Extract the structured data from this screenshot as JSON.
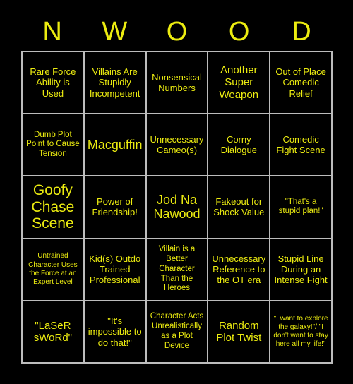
{
  "card": {
    "title_letters": [
      "N",
      "W",
      "O",
      "O",
      "D"
    ],
    "accent_color": "#ecec10",
    "background_color": "#000000",
    "gridline_color": "#bcbcbc",
    "rows": 5,
    "columns": 5,
    "cells": [
      {
        "text": "Rare Force Ability is Used",
        "size": "m"
      },
      {
        "text": "Villains Are Stupidly Incompetent",
        "size": "m"
      },
      {
        "text": "Nonsensical Numbers",
        "size": "m"
      },
      {
        "text": "Another Super Weapon",
        "size": "l"
      },
      {
        "text": "Out of Place Comedic Relief",
        "size": "m"
      },
      {
        "text": "Dumb Plot Point to Cause Tension",
        "size": "s"
      },
      {
        "text": "Macguffin",
        "size": "xl"
      },
      {
        "text": "Unnecessary Cameo(s)",
        "size": "m"
      },
      {
        "text": "Corny Dialogue",
        "size": "m"
      },
      {
        "text": "Comedic Fight Scene",
        "size": "m"
      },
      {
        "text": "Goofy Chase Scene",
        "size": "xxl"
      },
      {
        "text": "Power of Friendship!",
        "size": "m"
      },
      {
        "text": "Jod Na Nawood",
        "size": "xl"
      },
      {
        "text": "Fakeout for Shock Value",
        "size": "m"
      },
      {
        "text": "\"That's a stupid plan!\"",
        "size": "s"
      },
      {
        "text": "Untrained Character Uses the Force at an Expert Level",
        "size": "xs"
      },
      {
        "text": "Kid(s) Outdo Trained Professional",
        "size": "m"
      },
      {
        "text": "Villain is a Better Character Than the Heroes",
        "size": "s"
      },
      {
        "text": "Unnecessary Reference to the OT era",
        "size": "m"
      },
      {
        "text": "Stupid Line During an Intense Fight",
        "size": "m"
      },
      {
        "text": "\"LaSeR sWoRd\"",
        "size": "l"
      },
      {
        "text": "\"It's impossible to do that!\"",
        "size": "m"
      },
      {
        "text": "Character Acts Unrealistically as a Plot Device",
        "size": "s"
      },
      {
        "text": "Random Plot Twist",
        "size": "l"
      },
      {
        "text": "\"I want to explore the galaxy!\"/ \"I don't want to stay here all my life!\"",
        "size": "xs"
      }
    ]
  }
}
